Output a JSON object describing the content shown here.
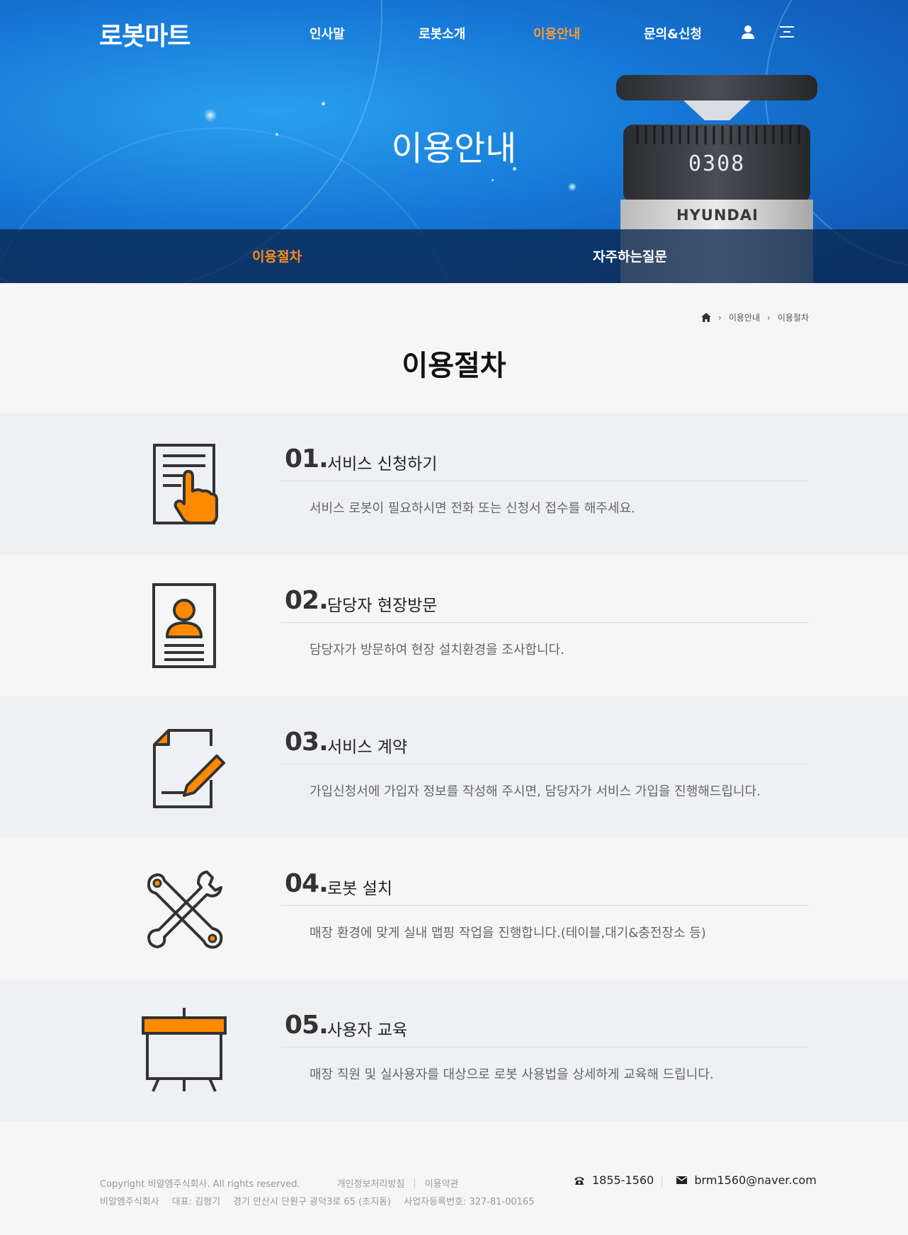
{
  "brand": {
    "logo": "로봇마트"
  },
  "menu": {
    "items": [
      {
        "label": "인사말"
      },
      {
        "label": "로봇소개"
      },
      {
        "label": "이용안내"
      },
      {
        "label": "문의&신청"
      }
    ],
    "active_color": "#ff9a2e"
  },
  "hero": {
    "title": "이용안내",
    "robot_brand": "HYUNDAI",
    "robot_display": "0308"
  },
  "subnav": {
    "tabs": [
      {
        "label": "이용절차"
      },
      {
        "label": "자주하는질문"
      }
    ],
    "active_color": "#ff8c1a"
  },
  "breadcrumb": {
    "items": [
      "이용안내",
      "이용절차"
    ]
  },
  "page": {
    "title": "이용절차"
  },
  "steps": [
    {
      "num": "01",
      "title": "서비스 신청하기",
      "desc": "서비스 로봇이 필요하시면 전화 또는 신청서 접수를 해주세요.",
      "icon": "document-touch-icon"
    },
    {
      "num": "02",
      "title": "담당자 현장방문",
      "desc": "담당자가 방문하여 현장 설치환경을 조사합니다.",
      "icon": "id-card-icon"
    },
    {
      "num": "03",
      "title": "서비스 계약",
      "desc": "가입신청서에 가입자 정보를 작성해 주시면, 담당자가 서비스 가입을 진행해드립니다.",
      "icon": "contract-pen-icon"
    },
    {
      "num": "04",
      "title": "로봇 설치",
      "desc": "매장 환경에 맞게 실내 맵핑 작업을 진행합니다.(테이블,대기&충전장소 등)",
      "icon": "wrench-tools-icon"
    },
    {
      "num": "05",
      "title": "사용자 교육",
      "desc": "매장 직원 및 실사용자를 대상으로 로봇 사용법을 상세하게 교육해 드립니다.",
      "icon": "presentation-board-icon"
    }
  ],
  "footer": {
    "copyright": "Copyright 비알엠주식회사. All rights reserved.",
    "privacy": "개인정보처리방침",
    "terms": "이용약관",
    "company": "비알엠주식회사",
    "ceo": "대표: 김형기",
    "address": "경기 안산시 단원구 광덕3로 65 (초지동)",
    "bizno": "사업자등록번호: 327-81-00165",
    "phone": "1855-1560",
    "email": "brm1560@naver.com"
  },
  "colors": {
    "accent": "#ff8a00",
    "icon_stroke": "#333333"
  }
}
